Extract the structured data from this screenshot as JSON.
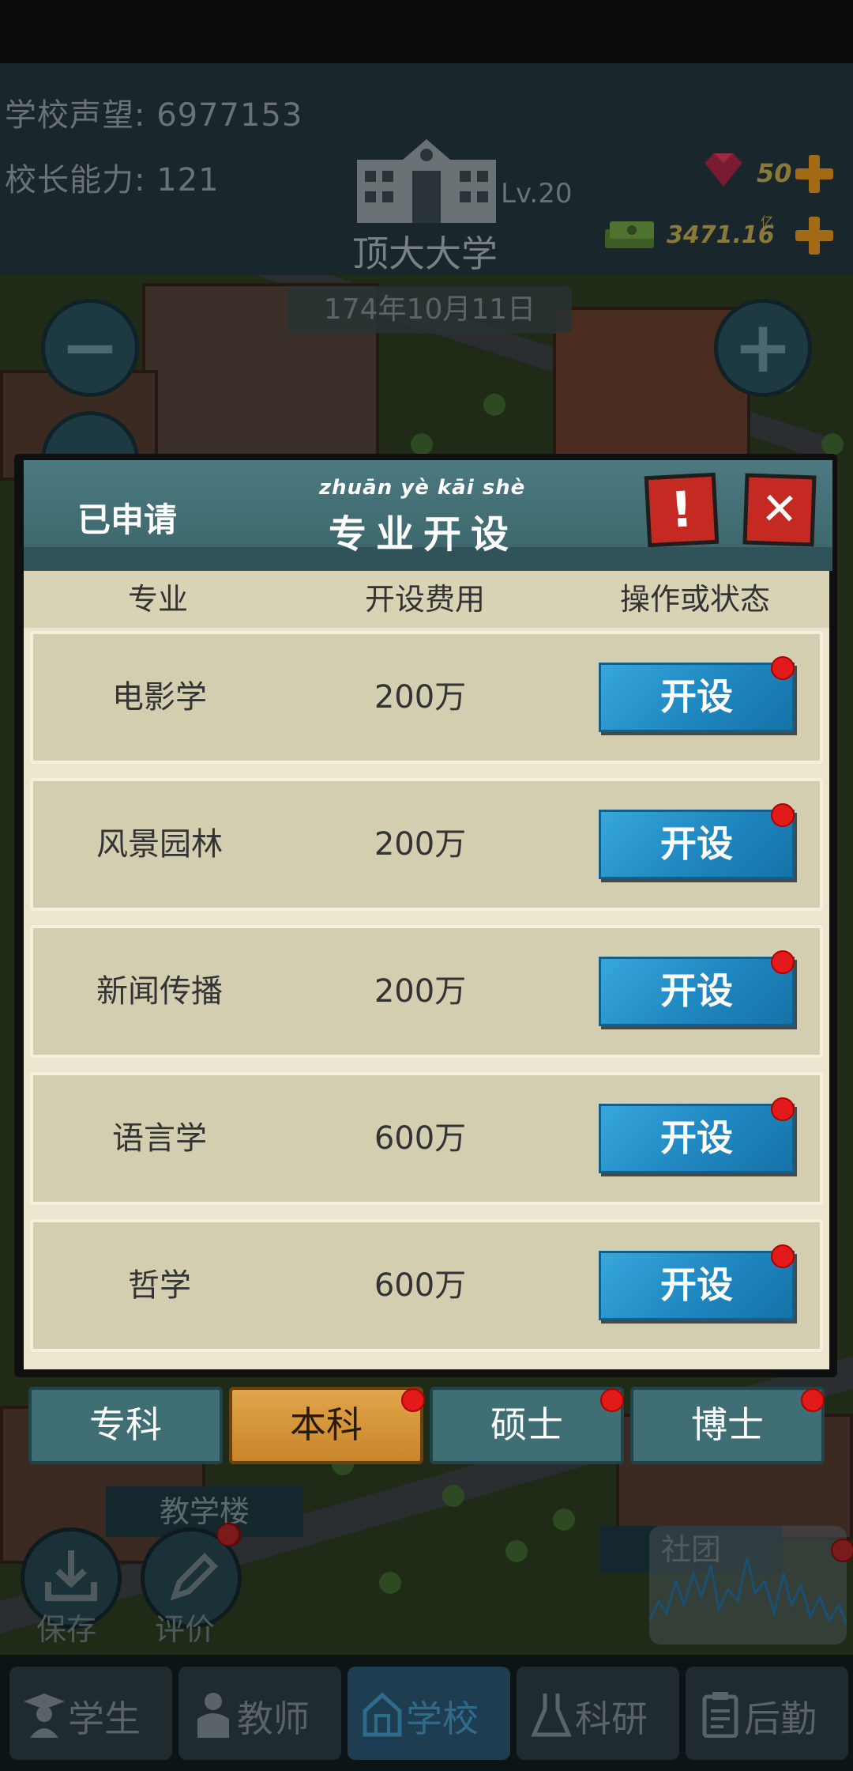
{
  "header": {
    "reputation_label": "学校声望:",
    "reputation_value": "6977153",
    "ability_label": "校长能力:",
    "ability_value": "121",
    "school_name": "顶大大学",
    "level": "Lv.20",
    "gems": "50",
    "money": "3471.16",
    "money_unit": "亿"
  },
  "map": {
    "date": "174年10月11日",
    "teaching_building_tag": "教学楼",
    "club_tag": "社团",
    "save_label": "保存",
    "rate_label": "评价"
  },
  "modal": {
    "applied_label": "已申请",
    "title_pinyin": "zhuān yè  kāi shè",
    "title": "专业开设",
    "info_button": "!",
    "close_button": "✕",
    "columns": [
      "专业",
      "开设费用",
      "操作或状态"
    ],
    "rows": [
      {
        "major": "电影学",
        "cost": "200万",
        "action": "开设"
      },
      {
        "major": "风景园林",
        "cost": "200万",
        "action": "开设"
      },
      {
        "major": "新闻传播",
        "cost": "200万",
        "action": "开设"
      },
      {
        "major": "语言学",
        "cost": "600万",
        "action": "开设"
      },
      {
        "major": "哲学",
        "cost": "600万",
        "action": "开设"
      }
    ]
  },
  "tabs": [
    "专科",
    "本科",
    "硕士",
    "博士"
  ],
  "active_tab": "本科",
  "bottom_nav": [
    "学生",
    "教师",
    "学校",
    "科研",
    "后勤"
  ],
  "active_nav": "学校",
  "colors": {
    "button_blue": "#1f86bf",
    "tab_active": "#e2a54a",
    "tab_default": "#3f6f75",
    "notification_red": "#e31a1a",
    "close_red": "#c42a22"
  }
}
